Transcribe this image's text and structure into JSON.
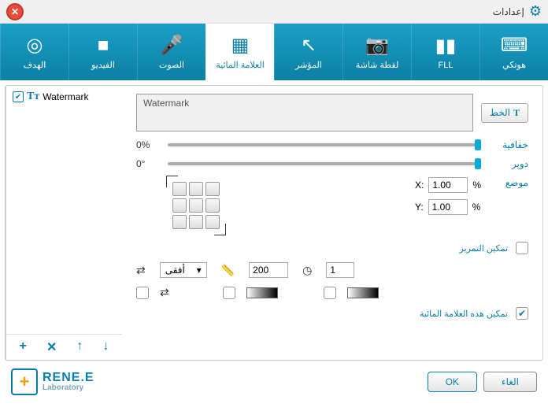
{
  "title": "إعدادات",
  "toolbar": [
    {
      "key": "target",
      "label": "الهدف",
      "icon": "◎"
    },
    {
      "key": "video",
      "label": "الفيديو",
      "icon": "■"
    },
    {
      "key": "audio",
      "label": "الصوت",
      "icon": "🎤"
    },
    {
      "key": "watermark",
      "label": "العلامة المائية",
      "icon": "▦",
      "active": true
    },
    {
      "key": "cursor",
      "label": "المؤشر",
      "icon": "↖"
    },
    {
      "key": "screenshot",
      "label": "لقطة شاشة",
      "icon": "📷"
    },
    {
      "key": "fll",
      "label": "FLL",
      "icon": "▮▮"
    },
    {
      "key": "hotkey",
      "label": "هوتكي",
      "icon": "⌨"
    }
  ],
  "sidebar": {
    "items": [
      {
        "label": "Watermark",
        "checked": true
      }
    ],
    "actions": {
      "add": "+",
      "remove": "✕",
      "up": "↑",
      "down": "↓"
    }
  },
  "panel": {
    "preview_text": "Watermark",
    "font_btn": "الخط",
    "opacity_label": "خفافية",
    "opacity_value": "0%",
    "rotate_label": "دوير",
    "rotate_value": "0°",
    "position_label": "موضع",
    "x_label": "X:",
    "x_value": "1.00",
    "y_label": "Y:",
    "y_value": "1.00",
    "percent": "%",
    "scroll_enable": "تمكين التمرير",
    "direction_value": "أفقى",
    "width_value": "200",
    "time_value": "1",
    "enable_watermark": "تمكين هذه العلامة المائية"
  },
  "logo": {
    "main": "RENE.E",
    "sub": "Laboratory"
  },
  "buttons": {
    "ok": "OK",
    "cancel": "الغاء"
  }
}
